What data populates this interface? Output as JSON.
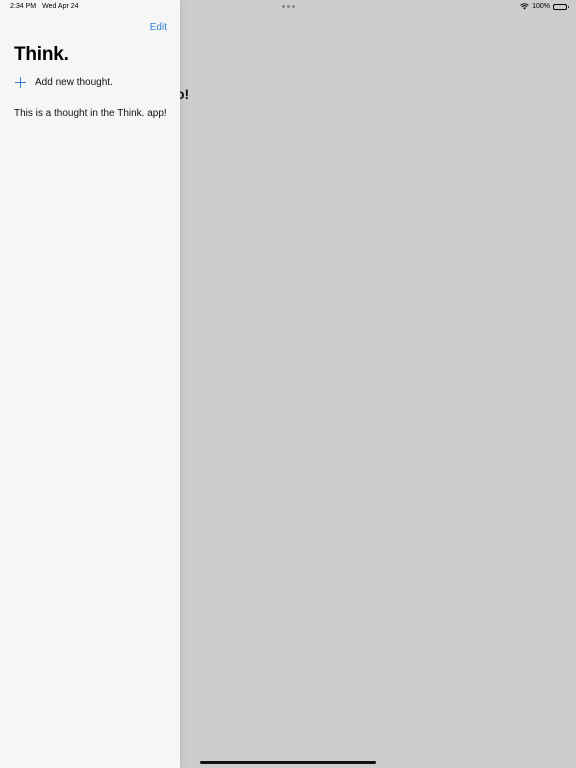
{
  "status_bar": {
    "time": "2:34 PM",
    "date": "Wed Apr 24",
    "battery": "100%",
    "wifi_icon": "wifi-icon",
    "battery_icon": "battery-icon"
  },
  "sidebar": {
    "edit_label": "Edit",
    "title": "Think.",
    "add_label": "Add new thought.",
    "add_icon": "plus-icon",
    "thoughts": [
      "This is a thought in the Think. app!"
    ]
  },
  "detail": {
    "title_visible": "o!"
  },
  "colors": {
    "accent": "#2f7fd1",
    "sidebar_bg": "#f6f6f6",
    "backdrop": "#cdcdcd"
  }
}
